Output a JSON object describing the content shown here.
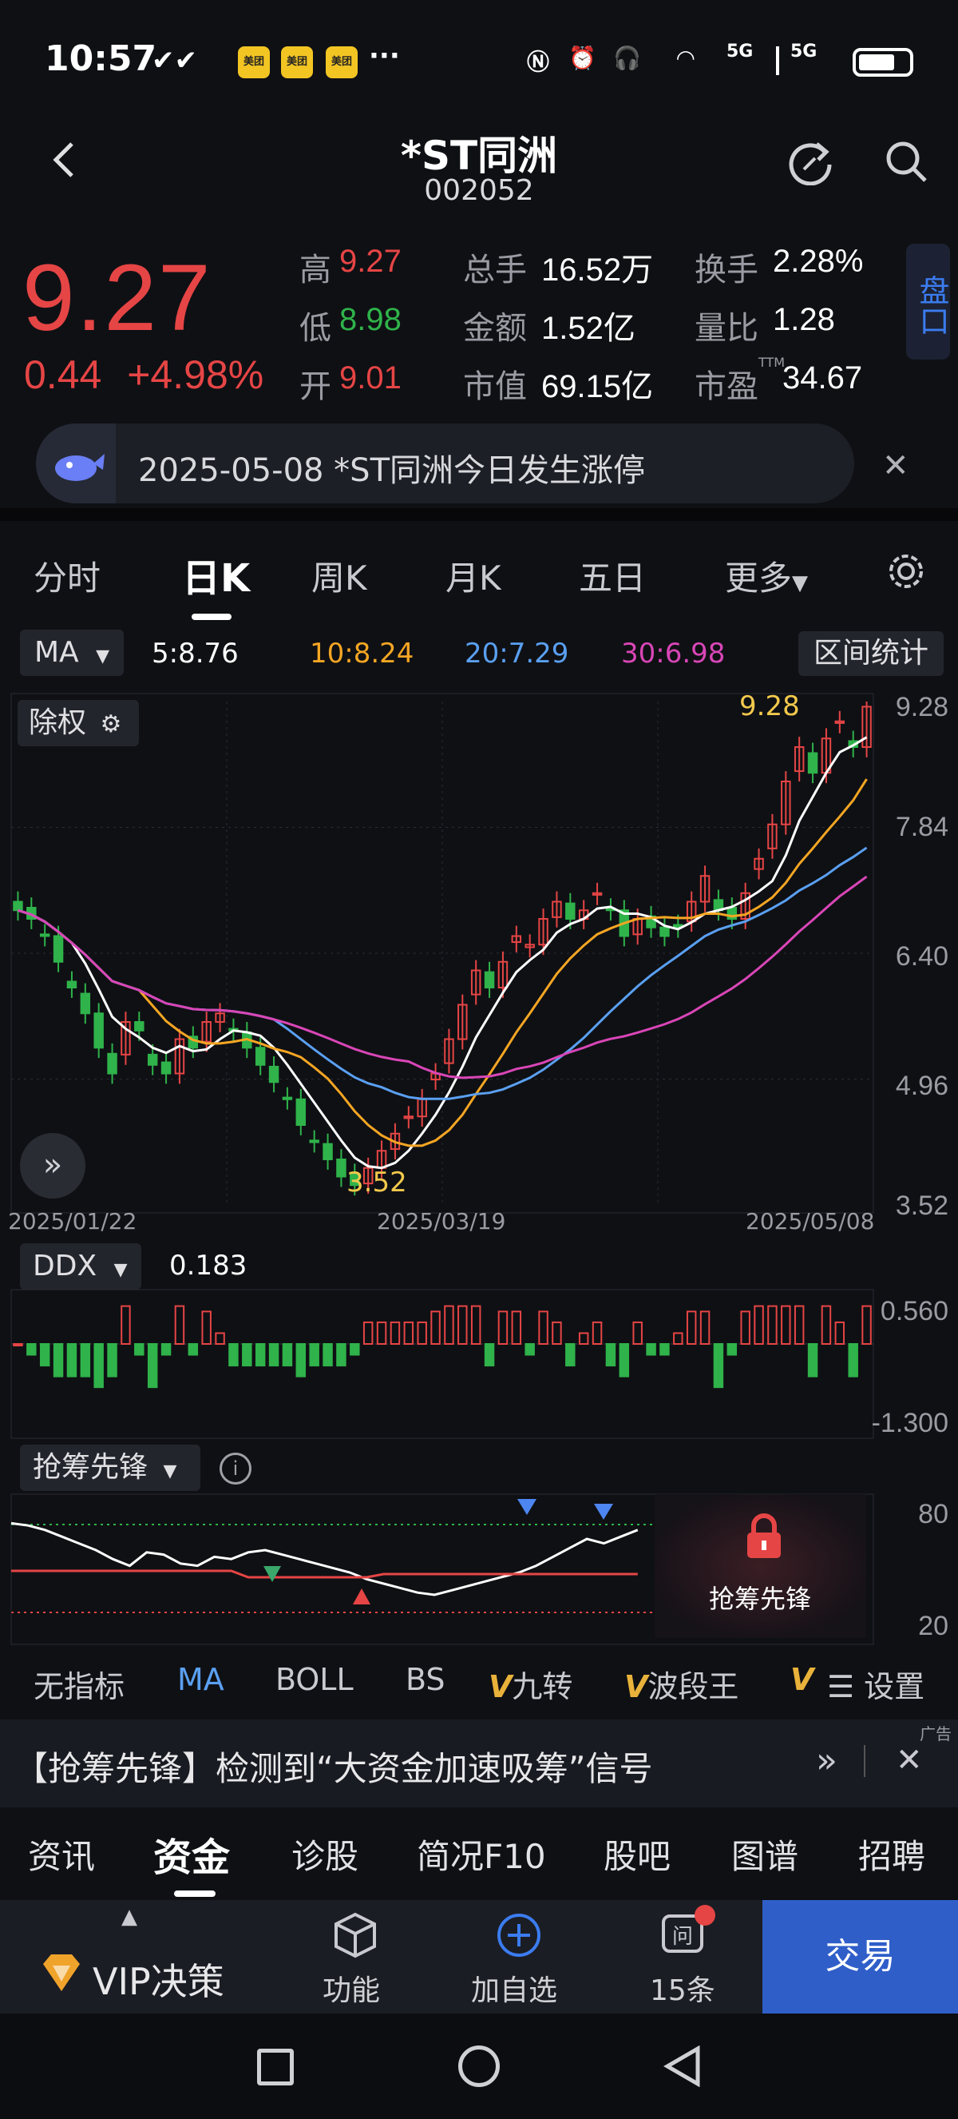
{
  "status_bar": {
    "time": "10:57",
    "app_badge": "美团",
    "more": "···",
    "signal": "5G",
    "signal2": "5G"
  },
  "header": {
    "name": "*ST同洲",
    "code": "002052"
  },
  "quote": {
    "price": "9.27",
    "change": "0.44",
    "change_pct": "+4.98%",
    "high_label": "高",
    "high": "9.27",
    "low_label": "低",
    "low": "8.98",
    "open_label": "开",
    "open": "9.01",
    "volume_label": "总手",
    "volume": "16.52万",
    "amount_label": "金额",
    "amount": "1.52亿",
    "mktcap_label": "市值",
    "mktcap": "69.15亿",
    "turnover_label": "换手",
    "turnover": "2.28%",
    "volratio_label": "量比",
    "volratio": "1.28",
    "pe_label": "市盈",
    "pe_sup": "TTM",
    "pe": "34.67",
    "panel_tab": "盘口"
  },
  "news": {
    "text": "2025-05-08 *ST同洲今日发生涨停"
  },
  "tabs": [
    "分时",
    "日K",
    "周K",
    "月K",
    "五日",
    "更多"
  ],
  "active_tab": "日K",
  "ma_legend": {
    "selector": "MA",
    "ma5": "5:8.76",
    "ma10": "10:8.24",
    "ma20": "20:7.29",
    "ma30": "30:6.98",
    "range_stats": "区间统计"
  },
  "chart": {
    "adjust_label": "除权",
    "y_ticks": [
      "9.28",
      "7.84",
      "6.40",
      "4.96",
      "3.52"
    ],
    "x_ticks": [
      "2025/01/22",
      "2025/03/19",
      "2025/05/08"
    ],
    "max_label": "9.28",
    "min_label": "3.52"
  },
  "ddx": {
    "selector": "DDX",
    "value": "0.183",
    "top": "0.560",
    "bottom": "-1.300"
  },
  "chip": {
    "selector": "抢筹先锋",
    "top": "80",
    "bottom": "20",
    "lock_label": "抢筹先锋"
  },
  "indicators": [
    "无指标",
    "MA",
    "BOLL",
    "BS",
    "九转",
    "波段王",
    "设置"
  ],
  "promo": {
    "text": "【抢筹先锋】检测到“大资金加速吸筹”信号",
    "ad": "广告"
  },
  "subtabs": [
    "资讯",
    "资金",
    "诊股",
    "简况F10",
    "股吧",
    "图谱",
    "招聘"
  ],
  "active_subtab": "资金",
  "bottom_nav": {
    "vip": "VIP决策",
    "func": "功能",
    "add": "加自选",
    "msgs": "15条",
    "trade": "交易"
  },
  "colors": {
    "up": "#e64545",
    "down": "#2fb34a",
    "ma5": "#ffffff",
    "ma10": "#f5a623",
    "ma20": "#5aa0f2",
    "ma30": "#d946b7",
    "trade": "#2f5ec9"
  },
  "chart_data": {
    "type": "candlestick",
    "x_labels": [
      "2025/01/22",
      "2025/03/19",
      "2025/05/08"
    ],
    "ylim": [
      3.52,
      9.28
    ],
    "last_close": 9.27,
    "ma": {
      "ma5": 8.76,
      "ma10": 8.24,
      "ma20": 7.29,
      "ma30": 6.98
    },
    "low_point": 3.52,
    "high_point": 9.28,
    "closes": [
      6.9,
      6.8,
      6.6,
      6.3,
      6.0,
      5.7,
      5.3,
      5.0,
      5.6,
      5.5,
      5.1,
      5.0,
      5.4,
      5.3,
      5.6,
      5.7,
      5.5,
      5.3,
      5.1,
      4.9,
      4.7,
      4.4,
      4.2,
      4.0,
      3.8,
      3.7,
      3.9,
      4.1,
      4.3,
      4.5,
      4.7,
      5.0,
      5.4,
      5.8,
      6.2,
      6.0,
      6.3,
      6.6,
      6.5,
      6.8,
      7.0,
      6.8,
      6.9,
      7.1,
      6.9,
      6.6,
      6.8,
      6.7,
      6.6,
      6.7,
      7.0,
      7.3,
      6.9,
      6.8,
      7.1,
      7.5,
      7.9,
      8.4,
      8.8,
      8.5,
      8.9,
      9.1,
      8.8,
      9.27
    ]
  }
}
